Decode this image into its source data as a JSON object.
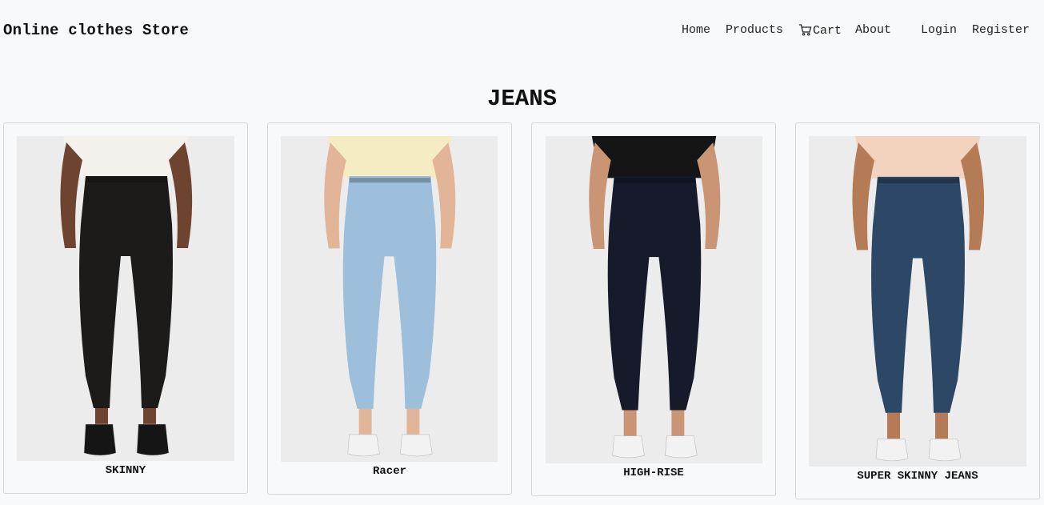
{
  "header": {
    "brand": "Online clothes Store",
    "nav": {
      "home": "Home",
      "products": "Products",
      "cart": "Cart",
      "about": "About",
      "login": "Login",
      "register": "Register"
    }
  },
  "main": {
    "title": "JEANS",
    "products": [
      {
        "name": "SKINNY",
        "jeans_color": "#1c1b1a",
        "top_color": "#f4f0ec",
        "shoe": "boot"
      },
      {
        "name": "Racer",
        "jeans_color": "#9dbfdc",
        "top_color": "#f5ecc4",
        "shoe": "sneaker"
      },
      {
        "name": "HIGH-RISE",
        "jeans_color": "#161a2b",
        "top_color": "#151515",
        "shoe": "sneaker"
      },
      {
        "name": "SUPER SKINNY JEANS",
        "jeans_color": "#2d4767",
        "top_color": "#f3d3bd",
        "shoe": "sneaker"
      }
    ]
  }
}
